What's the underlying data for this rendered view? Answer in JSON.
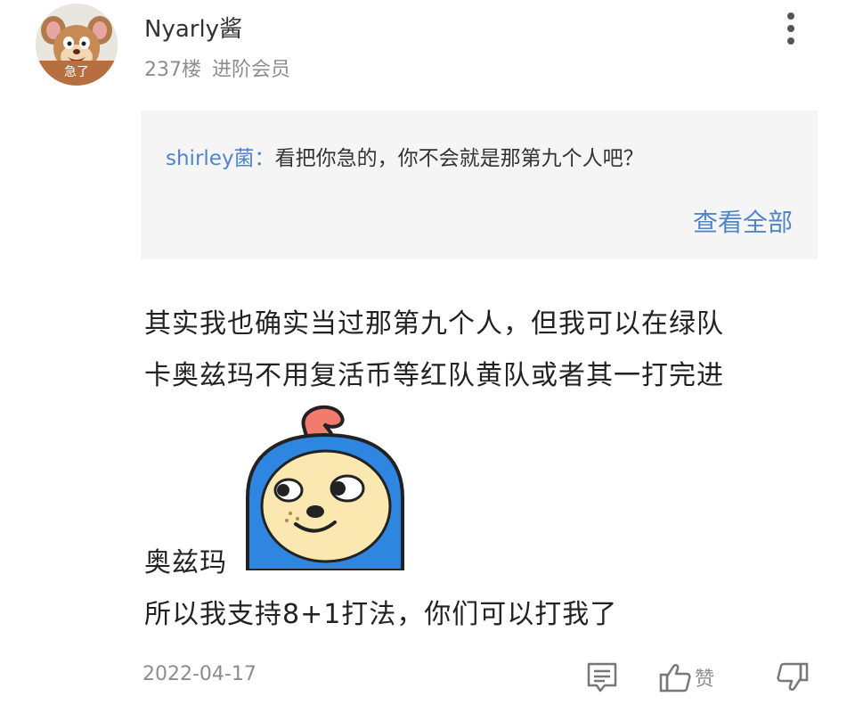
{
  "post": {
    "author": {
      "name": "Nyarly酱",
      "avatar_badge": "急了",
      "floor": "237楼",
      "level": "进阶会员"
    },
    "reply_preview": {
      "author": "shirley菌：",
      "text": "看把你急的，你不会就是那第九个人吧？",
      "view_all": "查看全部"
    },
    "content": {
      "line1": "其实我也确实当过那第九个人，但我可以在绿队",
      "line2": "卡奥兹玛不用复活币等红队黄队或者其一打完进",
      "line3": "奥兹玛",
      "line4": "所以我支持8+1打法，你们可以打我了"
    },
    "date": "2022-04-17",
    "actions": {
      "like_label": "赞"
    },
    "icons": {
      "more": "more-vertical-icon",
      "comment": "comment-icon",
      "like": "thumbs-up-icon",
      "dislike": "thumbs-down-icon"
    },
    "colors": {
      "link": "#5285c8",
      "muted": "#8d8d8d",
      "reply_bg": "#f5f5f5",
      "text": "#222222"
    }
  }
}
